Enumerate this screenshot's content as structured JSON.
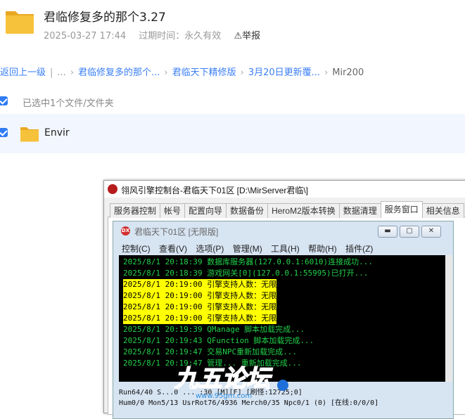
{
  "share": {
    "title": "君临修复多的那个3.27",
    "date": "2025-03-27 17:44",
    "expiry": "过期时间：永久有效",
    "report": "举报"
  },
  "breadcrumb": {
    "back": "返回上一级",
    "ellipsis": "...",
    "items": [
      "君临修复多的那个...",
      "君临天下精修版",
      "3月20日更新覆...",
      "Mir200"
    ]
  },
  "selection": {
    "text": "已选中1个文件/文件夹"
  },
  "file": {
    "name": "Envir"
  },
  "console_window": {
    "title": "翎风引擎控制台-君临天下01区 [D:\\MirServer君临\\]",
    "tabs": [
      "服务器控制",
      "帐号",
      "配置向导",
      "数据备份",
      "HeroM2版本转换",
      "数据清理",
      "服务窗口",
      "相关信息"
    ],
    "active_tab": "服务窗口",
    "inner_title": "君临天下01区 [无限版]",
    "inner_icon_text": "DX",
    "menu": [
      "控制(C)",
      "查看(V)",
      "选项(P)",
      "管理(M)",
      "工具(H)",
      "帮助(H)",
      "插件(Z)"
    ],
    "log": [
      {
        "text": "2025/8/1 20:18:39 数据库服务器(127.0.0.1:6010)连接成功...",
        "style": "green"
      },
      {
        "text": "2025/8/1 20:18:39 游戏网关[0](127.0.0.1:55995)已打开...",
        "style": "green"
      },
      {
        "text": "2025/8/1 20:19:00 引擎支持人数：无限",
        "style": "yellow"
      },
      {
        "text": "2025/8/1 20:19:00 引擎支持人数：无限",
        "style": "yellow"
      },
      {
        "text": "2025/8/1 20:19:00 引擎支持人数：无限",
        "style": "yellow"
      },
      {
        "text": "2025/8/1 20:19:00 引擎支持人数：无限",
        "style": "yellow"
      },
      {
        "text": "2025/8/1 20:19:39 QManage 脚本加载完成...",
        "style": "green"
      },
      {
        "text": "2025/8/1 20:19:43 QFunction 脚本加载完成...",
        "style": "green"
      },
      {
        "text": "2025/8/1 20:19:47 交易NPC重新加载完成...",
        "style": "green"
      },
      {
        "text": "2025/8/1 20:19:47 管理... 重新加载完成...",
        "style": "green"
      }
    ],
    "status_line1": "Run64/40 S...0 ...  :30 [M][F]     [刷怪:12725;0]",
    "status_line2": "Hum0/0 Mon5/13 UsrRot76/4936 Merch0/35 Npc0/1 (0)   [在线:0/0/0]"
  },
  "colors": {
    "folder": "#f7c23b",
    "link": "#3b7ff6",
    "console_green": "#22d14a",
    "console_highlight": "#ffff00"
  },
  "watermark": {
    "text": "九五论坛",
    "url": "www.95gm.com"
  }
}
